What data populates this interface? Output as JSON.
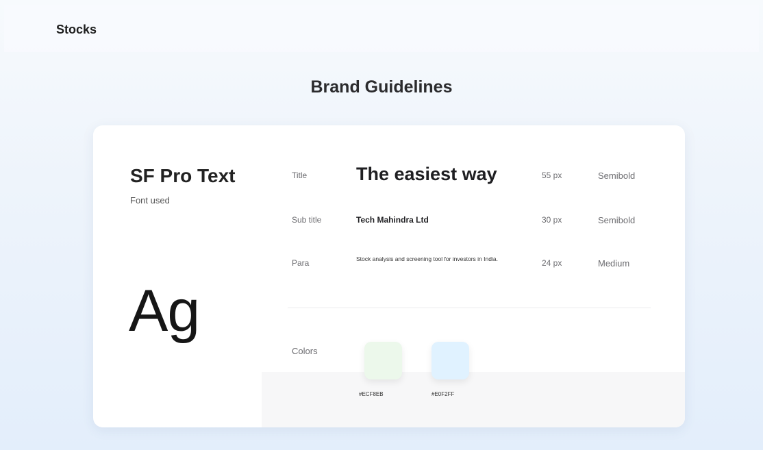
{
  "header": {
    "app_title": "Stocks"
  },
  "page": {
    "title": "Brand Guidelines"
  },
  "typography": {
    "font_name": "SF Pro Text",
    "font_caption": "Font used",
    "specimen": "Ag",
    "rows": [
      {
        "label": "Title",
        "sample": "The easiest way",
        "size": "55 px",
        "weight": "Semibold"
      },
      {
        "label": "Sub title",
        "sample": "Tech Mahindra Ltd",
        "size": "30 px",
        "weight": "Semibold"
      },
      {
        "label": "Para",
        "sample": "Stock analysis and screening tool for investors in India.",
        "size": "24 px",
        "weight": "Medium"
      }
    ]
  },
  "colors": {
    "label": "Colors",
    "swatches": [
      {
        "hex_label": "#ECF8EB",
        "color": "#ECF8EB"
      },
      {
        "hex_label": "#E0F2FF",
        "color": "#E0F2FF"
      }
    ]
  }
}
